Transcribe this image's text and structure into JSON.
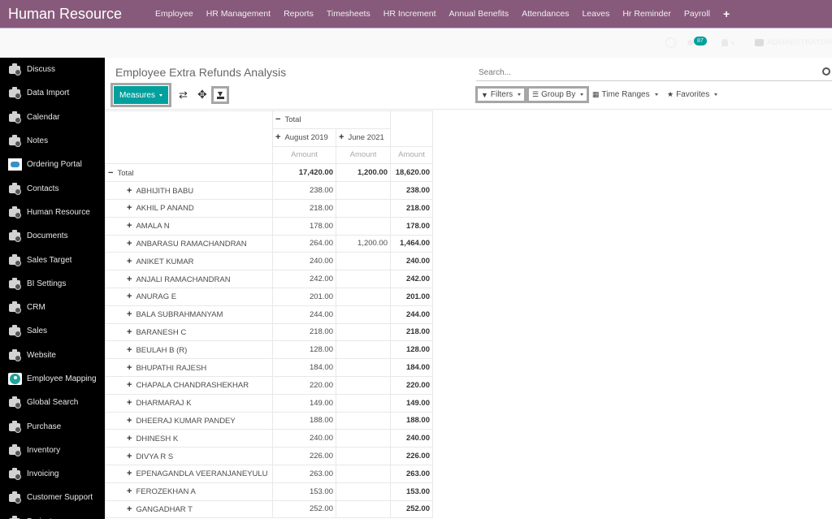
{
  "app": {
    "title": "Human Resource",
    "menu": [
      "Employee",
      "HR Management",
      "Reports",
      "Timesheets",
      "HR Increment",
      "Annual Benefits",
      "Attendances",
      "Leaves",
      "Hr Reminder",
      "Payroll"
    ],
    "menu_plus_icon": "plus-icon"
  },
  "systray": {
    "messages_badge": "87",
    "user_name": "ADMINISTRATOR"
  },
  "sidebar": {
    "items": [
      {
        "label": "Discuss",
        "icon": "camera-icon"
      },
      {
        "label": "Data Import",
        "icon": "camera-icon"
      },
      {
        "label": "Calendar",
        "icon": "camera-icon"
      },
      {
        "label": "Notes",
        "icon": "camera-icon"
      },
      {
        "label": "Ordering Portal",
        "icon": "handshake-icon"
      },
      {
        "label": "Contacts",
        "icon": "camera-icon"
      },
      {
        "label": "Human Resource",
        "icon": "camera-icon"
      },
      {
        "label": "Documents",
        "icon": "camera-icon"
      },
      {
        "label": "Sales Target",
        "icon": "camera-icon"
      },
      {
        "label": "BI Settings",
        "icon": "camera-icon"
      },
      {
        "label": "CRM",
        "icon": "camera-icon"
      },
      {
        "label": "Sales",
        "icon": "camera-icon"
      },
      {
        "label": "Website",
        "icon": "camera-icon"
      },
      {
        "label": "Employee Mapping",
        "icon": "map-pin-icon"
      },
      {
        "label": "Global Search",
        "icon": "camera-icon"
      },
      {
        "label": "Purchase",
        "icon": "camera-icon"
      },
      {
        "label": "Inventory",
        "icon": "camera-icon"
      },
      {
        "label": "Invoicing",
        "icon": "camera-icon"
      },
      {
        "label": "Customer Support",
        "icon": "camera-icon"
      },
      {
        "label": "Project",
        "icon": "camera-icon"
      }
    ]
  },
  "control_panel": {
    "title": "Employee Extra Refunds Analysis",
    "measures_label": "Measures",
    "search_placeholder": "Search...",
    "filters_label": "Filters",
    "group_by_label": "Group By",
    "time_ranges_label": "Time Ranges",
    "favorites_label": "Favorites"
  },
  "pivot": {
    "col_total_label": "Total",
    "col_groups": [
      "August 2019",
      "June 2021"
    ],
    "measure_label": "Amount",
    "row_total_label": "Total",
    "totals": [
      "17,420.00",
      "1,200.00",
      "18,620.00"
    ],
    "rows": [
      {
        "name": "ABHIJITH BABU",
        "aug2019": "238.00",
        "jun2021": "",
        "total": "238.00"
      },
      {
        "name": "AKHIL P ANAND",
        "aug2019": "218.00",
        "jun2021": "",
        "total": "218.00"
      },
      {
        "name": "AMALA N",
        "aug2019": "178.00",
        "jun2021": "",
        "total": "178.00"
      },
      {
        "name": "ANBARASU RAMACHANDRAN",
        "aug2019": "264.00",
        "jun2021": "1,200.00",
        "total": "1,464.00"
      },
      {
        "name": "ANIKET KUMAR",
        "aug2019": "240.00",
        "jun2021": "",
        "total": "240.00"
      },
      {
        "name": "ANJALI RAMACHANDRAN",
        "aug2019": "242.00",
        "jun2021": "",
        "total": "242.00"
      },
      {
        "name": "ANURAG E",
        "aug2019": "201.00",
        "jun2021": "",
        "total": "201.00"
      },
      {
        "name": "BALA SUBRAHMANYAM",
        "aug2019": "244.00",
        "jun2021": "",
        "total": "244.00"
      },
      {
        "name": "BARANESH C",
        "aug2019": "218.00",
        "jun2021": "",
        "total": "218.00"
      },
      {
        "name": "BEULAH B (R)",
        "aug2019": "128.00",
        "jun2021": "",
        "total": "128.00"
      },
      {
        "name": "BHUPATHI RAJESH",
        "aug2019": "184.00",
        "jun2021": "",
        "total": "184.00"
      },
      {
        "name": "CHAPALA CHANDRASHEKHAR",
        "aug2019": "220.00",
        "jun2021": "",
        "total": "220.00"
      },
      {
        "name": "DHARMARAJ K",
        "aug2019": "149.00",
        "jun2021": "",
        "total": "149.00"
      },
      {
        "name": "DHEERAJ KUMAR PANDEY",
        "aug2019": "188.00",
        "jun2021": "",
        "total": "188.00"
      },
      {
        "name": "DHINESH K",
        "aug2019": "240.00",
        "jun2021": "",
        "total": "240.00"
      },
      {
        "name": "DIVYA R S",
        "aug2019": "226.00",
        "jun2021": "",
        "total": "226.00"
      },
      {
        "name": "EPENAGANDLA VEERANJANEYULU",
        "aug2019": "263.00",
        "jun2021": "",
        "total": "263.00"
      },
      {
        "name": "FEROZEKHAN A",
        "aug2019": "153.00",
        "jun2021": "",
        "total": "153.00"
      },
      {
        "name": "GANGADHAR T",
        "aug2019": "252.00",
        "jun2021": "",
        "total": "252.00"
      }
    ]
  },
  "colors": {
    "brand": "#875a7b",
    "primary_button": "#00a09d",
    "sidebar_bg": "#000000"
  }
}
